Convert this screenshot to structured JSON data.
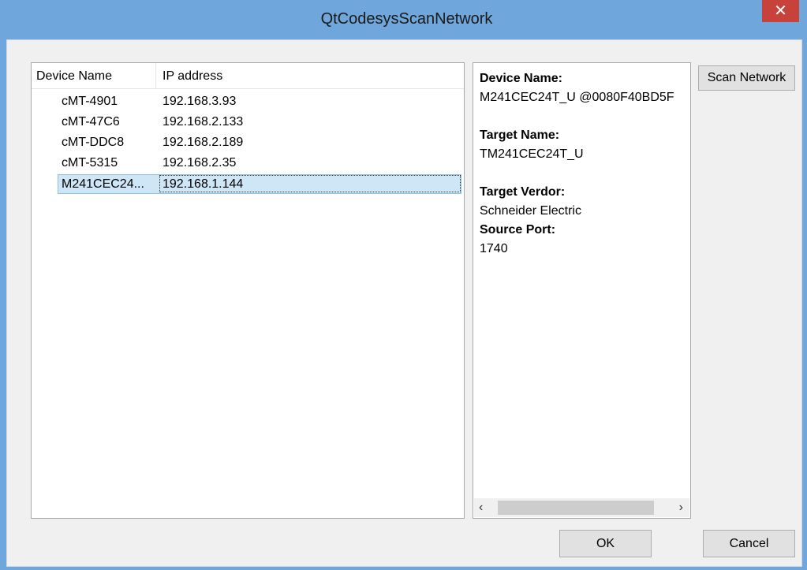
{
  "window": {
    "title": "QtCodesysScanNetwork",
    "close_glyph": "✕",
    "colors": {
      "frame": "#6fa6db",
      "close": "#c7423b",
      "selection": "#cfe6f7"
    }
  },
  "device_list": {
    "columns": [
      "Device Name",
      "IP address"
    ],
    "rows": [
      {
        "name": "cMT-4901",
        "ip": "192.168.3.93"
      },
      {
        "name": "cMT-47C6",
        "ip": "192.168.2.133"
      },
      {
        "name": "cMT-DDC8",
        "ip": "192.168.2.189"
      },
      {
        "name": "cMT-5315",
        "ip": "192.168.2.35"
      },
      {
        "name": "M241CEC24...",
        "ip": "192.168.1.144",
        "selected": true
      }
    ]
  },
  "details": {
    "device_name_label": "Device Name:",
    "device_name_value": "M241CEC24T_U @0080F40BD5F",
    "target_name_label": "Target Name:",
    "target_name_value": "TM241CEC24T_U",
    "target_vendor_label": "Target Verdor:",
    "target_vendor_value": "Schneider Electric",
    "source_port_label": "Source Port:",
    "source_port_value": "1740",
    "scroll_left_icon": "chevron-left-icon",
    "scroll_right_icon": "chevron-right-icon"
  },
  "buttons": {
    "scan": "Scan Network",
    "ok": "OK",
    "cancel": "Cancel"
  }
}
